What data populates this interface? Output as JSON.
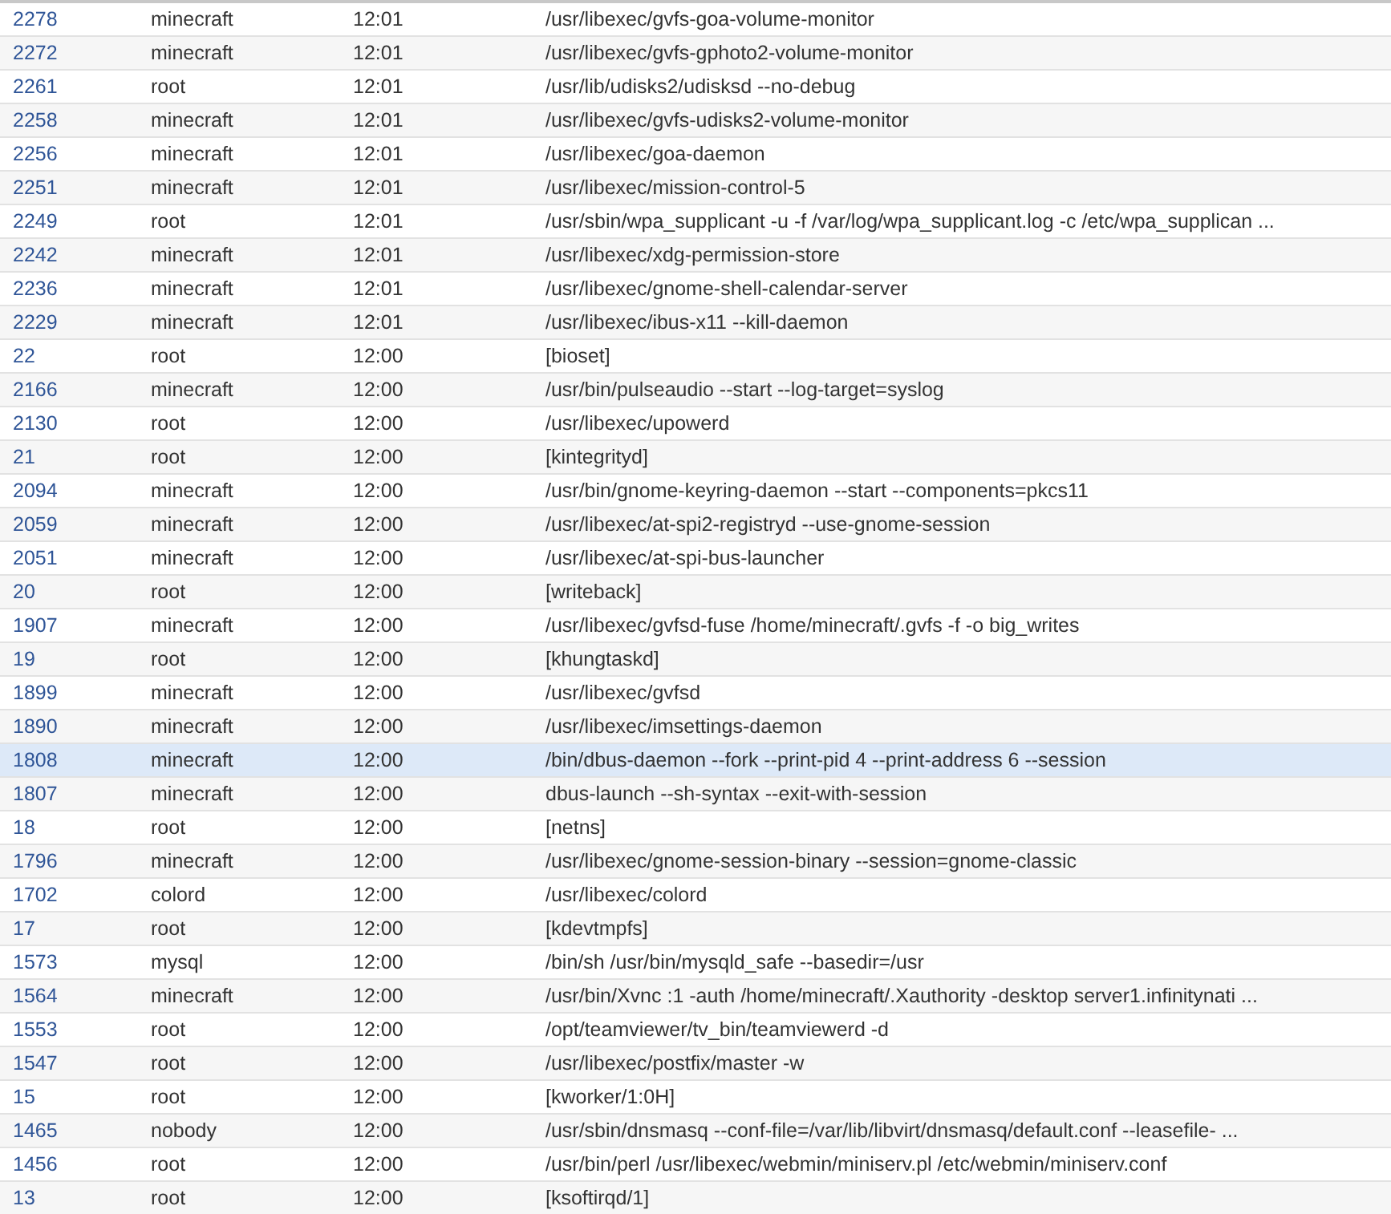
{
  "rows": [
    {
      "pid": "2278",
      "user": "minecraft",
      "time": "12:01",
      "command": "/usr/libexec/gvfs-goa-volume-monitor",
      "selected": false
    },
    {
      "pid": "2272",
      "user": "minecraft",
      "time": "12:01",
      "command": "/usr/libexec/gvfs-gphoto2-volume-monitor",
      "selected": false
    },
    {
      "pid": "2261",
      "user": "root",
      "time": "12:01",
      "command": "/usr/lib/udisks2/udisksd --no-debug",
      "selected": false
    },
    {
      "pid": "2258",
      "user": "minecraft",
      "time": "12:01",
      "command": "/usr/libexec/gvfs-udisks2-volume-monitor",
      "selected": false
    },
    {
      "pid": "2256",
      "user": "minecraft",
      "time": "12:01",
      "command": "/usr/libexec/goa-daemon",
      "selected": false
    },
    {
      "pid": "2251",
      "user": "minecraft",
      "time": "12:01",
      "command": "/usr/libexec/mission-control-5",
      "selected": false
    },
    {
      "pid": "2249",
      "user": "root",
      "time": "12:01",
      "command": "/usr/sbin/wpa_supplicant -u -f /var/log/wpa_supplicant.log -c /etc/wpa_supplican ...",
      "selected": false
    },
    {
      "pid": "2242",
      "user": "minecraft",
      "time": "12:01",
      "command": "/usr/libexec/xdg-permission-store",
      "selected": false
    },
    {
      "pid": "2236",
      "user": "minecraft",
      "time": "12:01",
      "command": "/usr/libexec/gnome-shell-calendar-server",
      "selected": false
    },
    {
      "pid": "2229",
      "user": "minecraft",
      "time": "12:01",
      "command": "/usr/libexec/ibus-x11 --kill-daemon",
      "selected": false
    },
    {
      "pid": "22",
      "user": "root",
      "time": "12:00",
      "command": "[bioset]",
      "selected": false
    },
    {
      "pid": "2166",
      "user": "minecraft",
      "time": "12:00",
      "command": "/usr/bin/pulseaudio --start --log-target=syslog",
      "selected": false
    },
    {
      "pid": "2130",
      "user": "root",
      "time": "12:00",
      "command": "/usr/libexec/upowerd",
      "selected": false
    },
    {
      "pid": "21",
      "user": "root",
      "time": "12:00",
      "command": "[kintegrityd]",
      "selected": false
    },
    {
      "pid": "2094",
      "user": "minecraft",
      "time": "12:00",
      "command": "/usr/bin/gnome-keyring-daemon --start --components=pkcs11",
      "selected": false
    },
    {
      "pid": "2059",
      "user": "minecraft",
      "time": "12:00",
      "command": "/usr/libexec/at-spi2-registryd --use-gnome-session",
      "selected": false
    },
    {
      "pid": "2051",
      "user": "minecraft",
      "time": "12:00",
      "command": "/usr/libexec/at-spi-bus-launcher",
      "selected": false
    },
    {
      "pid": "20",
      "user": "root",
      "time": "12:00",
      "command": "[writeback]",
      "selected": false
    },
    {
      "pid": "1907",
      "user": "minecraft",
      "time": "12:00",
      "command": "/usr/libexec/gvfsd-fuse /home/minecraft/.gvfs -f -o big_writes",
      "selected": false
    },
    {
      "pid": "19",
      "user": "root",
      "time": "12:00",
      "command": "[khungtaskd]",
      "selected": false
    },
    {
      "pid": "1899",
      "user": "minecraft",
      "time": "12:00",
      "command": "/usr/libexec/gvfsd",
      "selected": false
    },
    {
      "pid": "1890",
      "user": "minecraft",
      "time": "12:00",
      "command": "/usr/libexec/imsettings-daemon",
      "selected": false
    },
    {
      "pid": "1808",
      "user": "minecraft",
      "time": "12:00",
      "command": "/bin/dbus-daemon --fork --print-pid 4 --print-address 6 --session",
      "selected": true
    },
    {
      "pid": "1807",
      "user": "minecraft",
      "time": "12:00",
      "command": "dbus-launch --sh-syntax --exit-with-session",
      "selected": false
    },
    {
      "pid": "18",
      "user": "root",
      "time": "12:00",
      "command": "[netns]",
      "selected": false
    },
    {
      "pid": "1796",
      "user": "minecraft",
      "time": "12:00",
      "command": "/usr/libexec/gnome-session-binary --session=gnome-classic",
      "selected": false
    },
    {
      "pid": "1702",
      "user": "colord",
      "time": "12:00",
      "command": "/usr/libexec/colord",
      "selected": false
    },
    {
      "pid": "17",
      "user": "root",
      "time": "12:00",
      "command": "[kdevtmpfs]",
      "selected": false
    },
    {
      "pid": "1573",
      "user": "mysql",
      "time": "12:00",
      "command": "/bin/sh /usr/bin/mysqld_safe --basedir=/usr",
      "selected": false
    },
    {
      "pid": "1564",
      "user": "minecraft",
      "time": "12:00",
      "command": "/usr/bin/Xvnc :1 -auth /home/minecraft/.Xauthority -desktop server1.infinitynati ...",
      "selected": false
    },
    {
      "pid": "1553",
      "user": "root",
      "time": "12:00",
      "command": "/opt/teamviewer/tv_bin/teamviewerd -d",
      "selected": false
    },
    {
      "pid": "1547",
      "user": "root",
      "time": "12:00",
      "command": "/usr/libexec/postfix/master -w",
      "selected": false
    },
    {
      "pid": "15",
      "user": "root",
      "time": "12:00",
      "command": "[kworker/1:0H]",
      "selected": false
    },
    {
      "pid": "1465",
      "user": "nobody",
      "time": "12:00",
      "command": "/usr/sbin/dnsmasq --conf-file=/var/lib/libvirt/dnsmasq/default.conf --leasefile- ...",
      "selected": false
    },
    {
      "pid": "1456",
      "user": "root",
      "time": "12:00",
      "command": "/usr/bin/perl /usr/libexec/webmin/miniserv.pl /etc/webmin/miniserv.conf",
      "selected": false
    },
    {
      "pid": "13",
      "user": "root",
      "time": "12:00",
      "command": "[ksoftirqd/1]",
      "selected": false
    }
  ]
}
